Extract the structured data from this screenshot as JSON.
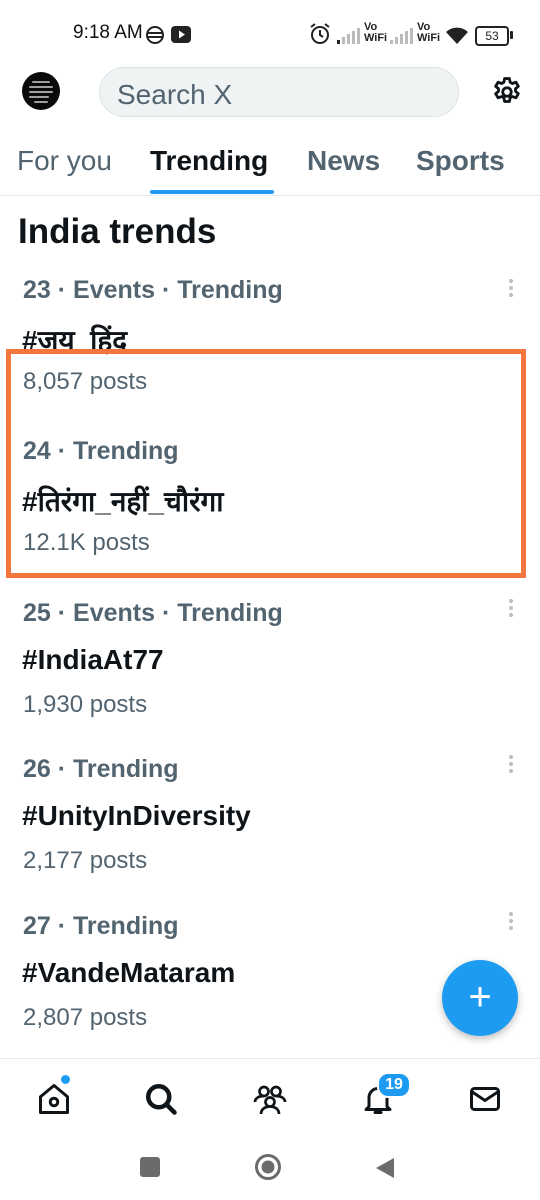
{
  "status_bar": {
    "time": "9:18 AM",
    "battery": "53",
    "icons": [
      "data-saver-icon",
      "youtube-icon",
      "alarm-icon",
      "signal-icon",
      "vowifi-icon",
      "wifi-icon",
      "battery-icon"
    ],
    "vowifi_label": "Vo WiFi"
  },
  "header": {
    "search_placeholder": "Search X"
  },
  "tabs": [
    {
      "label": "For you",
      "active": false
    },
    {
      "label": "Trending",
      "active": true
    },
    {
      "label": "News",
      "active": false
    },
    {
      "label": "Sports",
      "active": false
    }
  ],
  "section_title": "India trends",
  "trends": [
    {
      "meta": "23 · Events · Trending",
      "name": "#जय_हिंद",
      "posts": "8,057 posts"
    },
    {
      "meta": "24 · Trending",
      "name": "#तिरंगा_नहीं_चौरंगा",
      "posts": "12.1K posts"
    },
    {
      "meta": "25 · Events · Trending",
      "name": "#IndiaAt77",
      "posts": "1,930 posts"
    },
    {
      "meta": "26 · Trending",
      "name": "#UnityInDiversity",
      "posts": "2,177 posts"
    },
    {
      "meta": "27 · Trending",
      "name": "#VandeMataram",
      "posts": "2,807 posts"
    }
  ],
  "fab": {
    "symbol": "+"
  },
  "bottom_nav": {
    "items": [
      "home-icon",
      "search-icon",
      "communities-icon",
      "notifications-icon",
      "messages-icon"
    ],
    "notification_count": "19"
  },
  "android_nav": [
    "recents-button",
    "home-button",
    "back-button"
  ],
  "colors": {
    "accent": "#1d9bf0",
    "highlight": "#f4763f",
    "secondary_text": "#536471"
  }
}
